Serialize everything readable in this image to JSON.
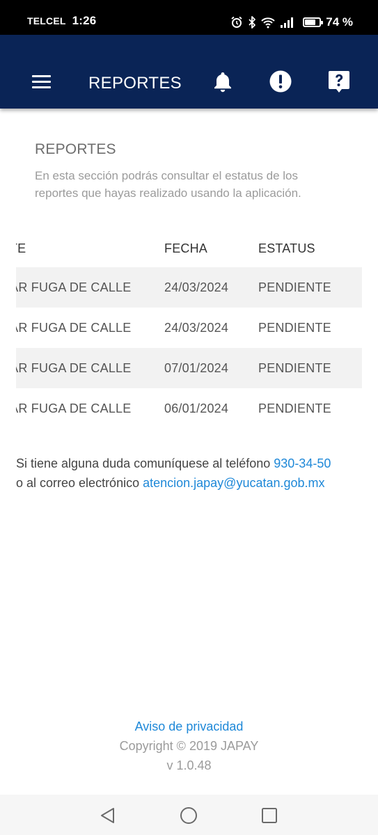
{
  "status_bar": {
    "carrier": "TELCEL",
    "time": "1:26",
    "battery_text": "74 %",
    "battery_level": 0.74,
    "icons": [
      "alarm-icon",
      "bluetooth-icon",
      "wifi-icon",
      "signal-icon",
      "battery-icon"
    ]
  },
  "header": {
    "title": "REPORTES",
    "background": "#0a2456",
    "icons": [
      "menu-icon",
      "bell-icon",
      "alert-icon",
      "help-icon"
    ]
  },
  "section": {
    "title": "REPORTES",
    "description": "En esta sección podrás consultar el estatus de los reportes que hayas realizado usando la aplicación."
  },
  "table": {
    "columns": [
      "RTE",
      "FECHA",
      "ESTATUS"
    ],
    "rows": [
      {
        "reporte": "RAR FUGA DE CALLE",
        "fecha": "24/03/2024",
        "estatus": "PENDIENTE"
      },
      {
        "reporte": "RAR FUGA DE CALLE",
        "fecha": "24/03/2024",
        "estatus": "PENDIENTE"
      },
      {
        "reporte": "RAR FUGA DE CALLE",
        "fecha": "07/01/2024",
        "estatus": "PENDIENTE"
      },
      {
        "reporte": "RAR FUGA DE CALLE",
        "fecha": "06/01/2024",
        "estatus": "PENDIENTE"
      }
    ]
  },
  "contact": {
    "line1_text": "Si tiene alguna duda comuníquese al teléfono ",
    "phone": "930-34-50",
    "line2_text": "o al correo electrónico ",
    "email": "atencion.japay@yucatan.gob.mx",
    "link_color": "#1e88d8"
  },
  "footer": {
    "privacy": "Aviso de privacidad",
    "copyright": "Copyright © 2019 JAPAY",
    "version": "v 1.0.48"
  },
  "nav": {
    "icons": [
      "back-icon",
      "home-icon",
      "recents-icon"
    ]
  }
}
